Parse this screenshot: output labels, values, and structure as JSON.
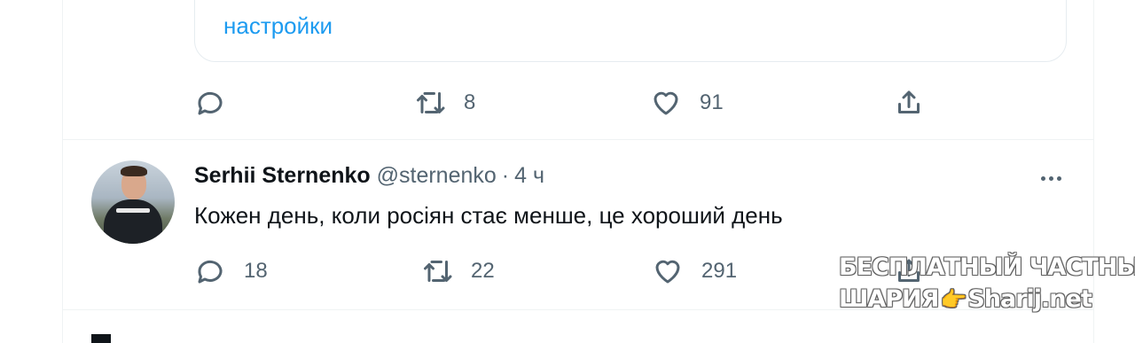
{
  "previous_tweet": {
    "card_link": "настройки",
    "actions": {
      "reply_count": "",
      "retweet_count": "8",
      "like_count": "91"
    }
  },
  "tweet": {
    "author_name": "Serhii Sternenko",
    "handle": "@sternenko",
    "separator": "·",
    "time": "4 ч",
    "text": "Кожен день, коли росіян стає менше, це хороший день",
    "actions": {
      "reply_count": "18",
      "retweet_count": "22",
      "like_count": "291"
    }
  },
  "watermark": {
    "line1": "БЕСПЛАТНЫЙ ЧАСТНЫЙ",
    "line2_left": "ШАРИЯ",
    "line2_icon": "pointing-hand",
    "line2_right": "Sharij.net"
  },
  "colors": {
    "accent": "#1d9bf0",
    "muted": "#536471",
    "text": "#0f1419",
    "divider": "#eff3f4"
  }
}
